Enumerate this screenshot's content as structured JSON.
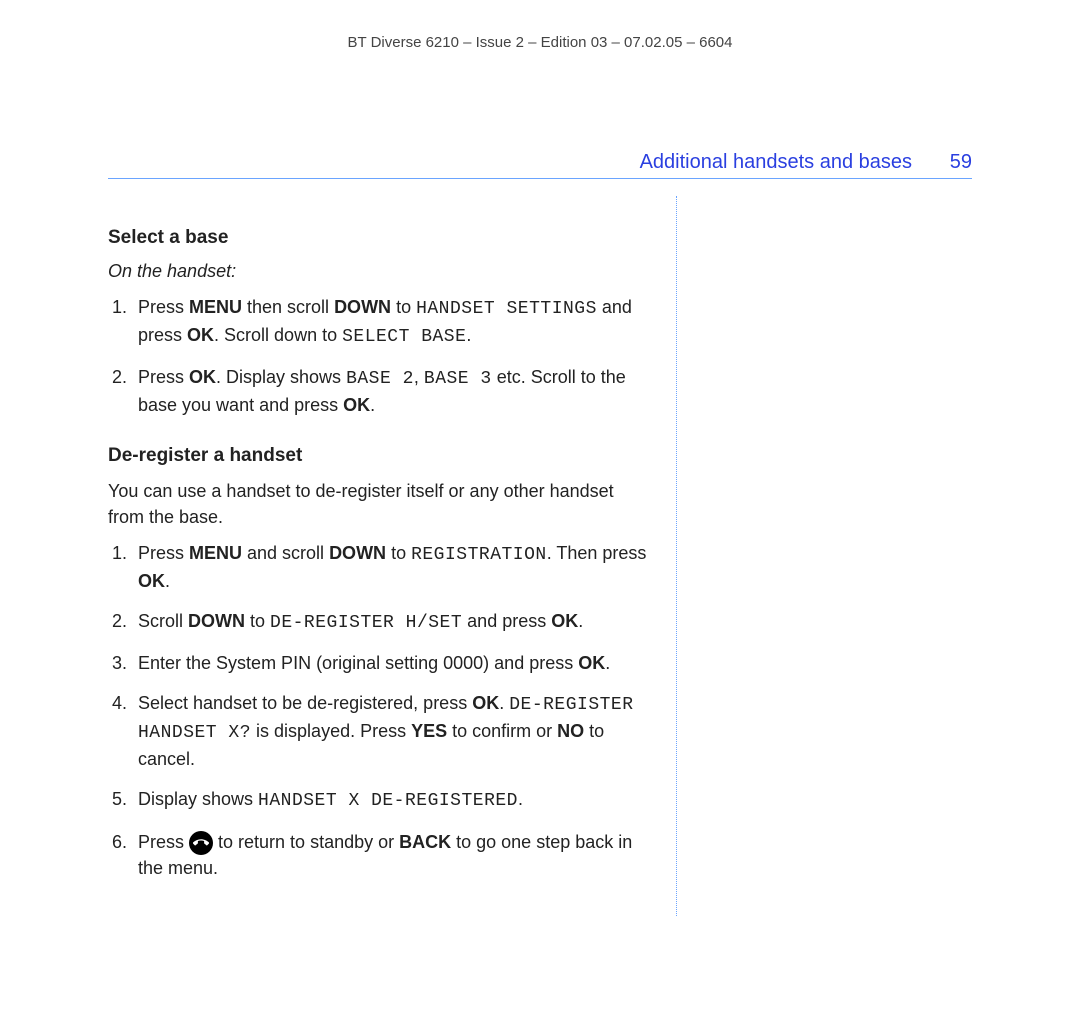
{
  "header": {
    "doc_line": "BT Diverse 6210 – Issue 2 – Edition 03 – 07.02.05 – 6604"
  },
  "section": {
    "title": "Additional handsets and bases",
    "page_number": "59"
  },
  "select_base": {
    "heading": "Select a base",
    "subhead": "On the handset:",
    "step1": {
      "a": "Press ",
      "menu": "MENU",
      "b": " then scroll ",
      "down": "DOWN",
      "c": " to ",
      "disp1": "HANDSET SETTINGS",
      "d": " and press ",
      "ok": "OK",
      "e": ". Scroll down to ",
      "disp2": "SELECT BASE",
      "f": "."
    },
    "step2": {
      "a": "Press ",
      "ok1": "OK",
      "b": ". Display shows ",
      "disp1": "BASE 2",
      "c": ", ",
      "disp2": "BASE 3",
      "d": " etc. Scroll to the base you want and press ",
      "ok2": "OK",
      "e": "."
    }
  },
  "dereg": {
    "heading": "De-register a handset",
    "intro": "You can use a handset to de-register itself or any other handset from the base.",
    "step1": {
      "a": "Press ",
      "menu": "MENU",
      "b": " and scroll ",
      "down": "DOWN",
      "c": " to ",
      "disp1": "REGISTRATION",
      "d": ". Then press ",
      "ok": "OK",
      "e": "."
    },
    "step2": {
      "a": "Scroll ",
      "down": "DOWN",
      "b": " to ",
      "disp1": "DE-REGISTER H/SET",
      "c": " and press ",
      "ok": "OK",
      "d": "."
    },
    "step3": {
      "a": "Enter the System PIN (original setting 0000) and press ",
      "ok": "OK",
      "b": "."
    },
    "step4": {
      "a": "Select handset to be de-registered, press ",
      "ok": "OK",
      "b": ". ",
      "disp1": "DE-REGISTER HANDSET X?",
      "c": " is displayed. Press ",
      "yes": "YES",
      "d": " to confirm or ",
      "no": "NO",
      "e": " to cancel."
    },
    "step5": {
      "a": "Display shows ",
      "disp1": "HANDSET X DE-REGISTERED",
      "b": "."
    },
    "step6": {
      "a": "Press ",
      "b": " to return to standby or ",
      "back": "BACK",
      "c": " to go one step back in the menu."
    }
  }
}
